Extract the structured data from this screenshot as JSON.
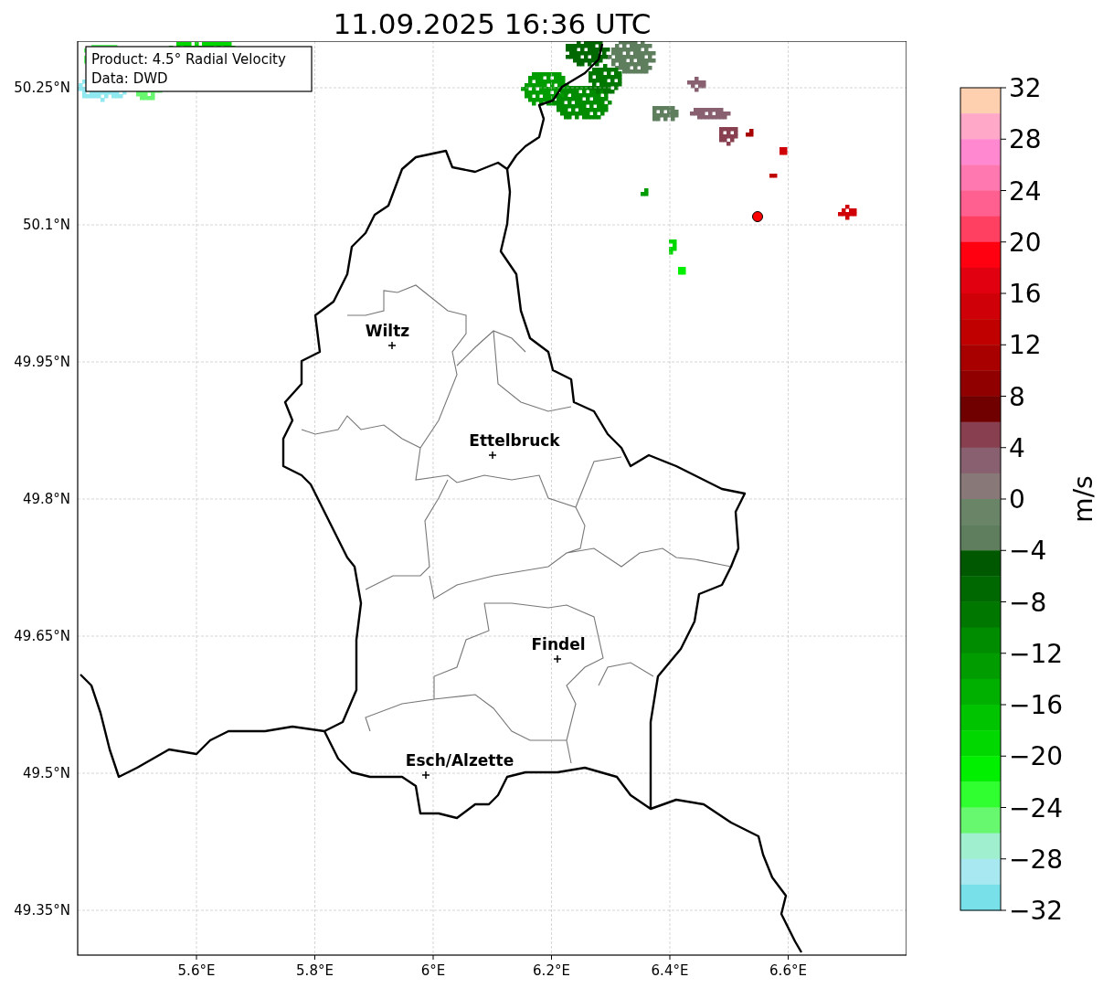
{
  "title": "11.09.2025 16:36 UTC",
  "info_box": {
    "product": "Product: 4.5° Radial Velocity",
    "data": "Data: DWD"
  },
  "map": {
    "xticks": [
      "5.6°E",
      "5.8°E",
      "6°E",
      "6.2°E",
      "6.4°E",
      "6.6°E"
    ],
    "yticks": [
      "50.25°N",
      "50.1°N",
      "49.95°N",
      "49.8°N",
      "49.65°N",
      "49.5°N",
      "49.35°N"
    ],
    "cities": [
      {
        "name": "Wiltz"
      },
      {
        "name": "Ettelbruck"
      },
      {
        "name": "Findel"
      },
      {
        "name": "Esch/Alzette"
      }
    ]
  },
  "colorbar": {
    "label": "m/s",
    "ticks": [
      "32",
      "28",
      "24",
      "20",
      "16",
      "12",
      "8",
      "4",
      "0",
      "−4",
      "−8",
      "−12",
      "−16",
      "−20",
      "−24",
      "−28",
      "−32"
    ],
    "bins": [
      {
        "color": "#ffd0b0"
      },
      {
        "color": "#ffa8c8"
      },
      {
        "color": "#ff88d0"
      },
      {
        "color": "#ff78b0"
      },
      {
        "color": "#ff6090"
      },
      {
        "color": "#ff4060"
      },
      {
        "color": "#ff0010"
      },
      {
        "color": "#e00010"
      },
      {
        "color": "#d00008"
      },
      {
        "color": "#c00000"
      },
      {
        "color": "#a80000"
      },
      {
        "color": "#900000"
      },
      {
        "color": "#700000"
      },
      {
        "color": "#884050"
      },
      {
        "color": "#886070"
      },
      {
        "color": "#887878"
      },
      {
        "color": "#6a8468"
      },
      {
        "color": "#5e7e5e"
      },
      {
        "color": "#005800"
      },
      {
        "color": "#006800"
      },
      {
        "color": "#007800"
      },
      {
        "color": "#008c00"
      },
      {
        "color": "#009c00"
      },
      {
        "color": "#00b000"
      },
      {
        "color": "#00c400"
      },
      {
        "color": "#00d800"
      },
      {
        "color": "#00f000"
      },
      {
        "color": "#30ff30"
      },
      {
        "color": "#68f870"
      },
      {
        "color": "#a0f0d0"
      },
      {
        "color": "#a8e8f0"
      },
      {
        "color": "#78e0e8"
      }
    ]
  }
}
